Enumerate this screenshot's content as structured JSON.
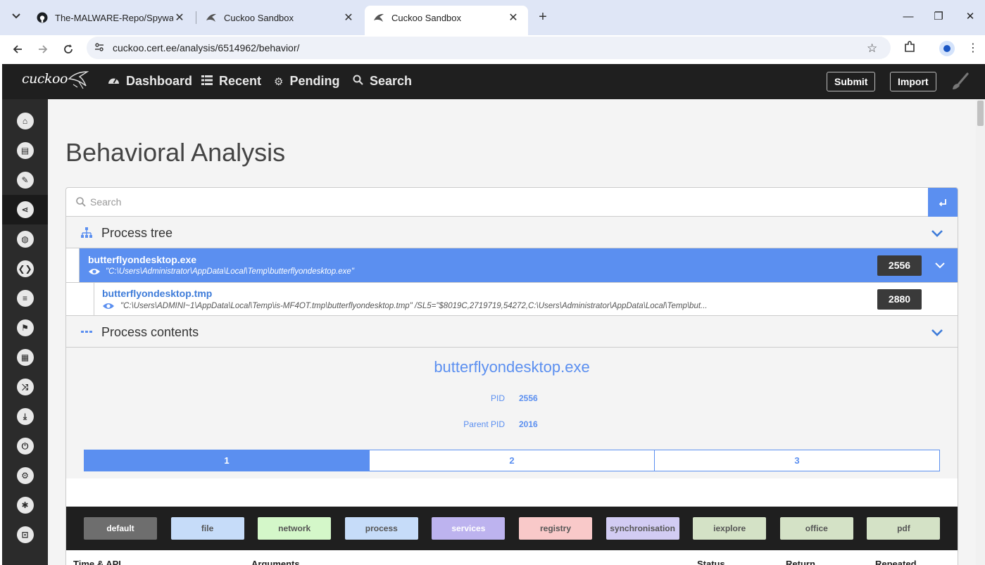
{
  "browser": {
    "tabs": [
      {
        "title": "The-MALWARE-Repo/Spyware/",
        "favicon": "github-icon",
        "active": false
      },
      {
        "title": "Cuckoo Sandbox",
        "favicon": "cuckoo-icon",
        "active": false
      },
      {
        "title": "Cuckoo Sandbox",
        "favicon": "cuckoo-icon",
        "active": true
      }
    ],
    "url": "cuckoo.cert.ee/analysis/6514962/behavior/"
  },
  "navbar": {
    "logo": "cuckoo",
    "items": [
      {
        "label": "Dashboard",
        "icon": "dashboard-icon"
      },
      {
        "label": "Recent",
        "icon": "list-icon"
      },
      {
        "label": "Pending",
        "icon": "cogs-icon"
      },
      {
        "label": "Search",
        "icon": "search-icon"
      }
    ],
    "submit_label": "Submit",
    "import_label": "Import"
  },
  "sidebar": {
    "items": [
      {
        "icon": "home-icon",
        "glyph": "⌂"
      },
      {
        "icon": "book-icon",
        "glyph": "▤"
      },
      {
        "icon": "pencil-icon",
        "glyph": "✎"
      },
      {
        "icon": "share-icon",
        "glyph": "⋖",
        "active": true
      },
      {
        "icon": "globe-icon",
        "glyph": "◍"
      },
      {
        "icon": "file-code-icon",
        "glyph": "❮❯"
      },
      {
        "icon": "server-icon",
        "glyph": "≡"
      },
      {
        "icon": "flag-icon",
        "glyph": "⚑"
      },
      {
        "icon": "qrcode-icon",
        "glyph": "▦"
      },
      {
        "icon": "shuffle-icon",
        "glyph": "⤨"
      },
      {
        "icon": "download-icon",
        "glyph": "⤓"
      },
      {
        "icon": "power-icon",
        "glyph": "⏻"
      },
      {
        "icon": "cogs-icon",
        "glyph": "⚙"
      },
      {
        "icon": "bug-icon",
        "glyph": "✱"
      },
      {
        "icon": "unlock-icon",
        "glyph": "⊡"
      }
    ]
  },
  "page": {
    "title": "Behavioral Analysis",
    "search_placeholder": "Search"
  },
  "process_tree": {
    "title": "Process tree",
    "processes": [
      {
        "name": "butterflyondesktop.exe",
        "cmd": "\"C:\\Users\\Administrator\\AppData\\Local\\Temp\\butterflyondesktop.exe\"",
        "pid": "2556",
        "selected": true
      },
      {
        "name": "butterflyondesktop.tmp",
        "cmd": "\"C:\\Users\\ADMINI~1\\AppData\\Local\\Temp\\is-MF4OT.tmp\\butterflyondesktop.tmp\" /SL5=\"$8019C,2719719,54272,C:\\Users\\Administrator\\AppData\\Local\\Temp\\but...",
        "pid": "2880",
        "selected": false
      }
    ]
  },
  "process_contents": {
    "title": "Process contents",
    "process_name": "butterflyondesktop.exe",
    "pid_label": "PID",
    "pid": "2556",
    "parent_pid_label": "Parent PID",
    "parent_pid": "2016",
    "pages": [
      "1",
      "2",
      "3"
    ],
    "active_page": "1"
  },
  "filters": [
    {
      "label": "default",
      "color": "#6e6e6e",
      "text_color": "#ffffff"
    },
    {
      "label": "file",
      "color": "#c6dcf9",
      "text_color": "#555555"
    },
    {
      "label": "network",
      "color": "#d4f7c9",
      "text_color": "#555555"
    },
    {
      "label": "process",
      "color": "#c6dcf9",
      "text_color": "#555555"
    },
    {
      "label": "services",
      "color": "#bdb3ef",
      "text_color": "#ffffff"
    },
    {
      "label": "registry",
      "color": "#f9c9c9",
      "text_color": "#555555"
    },
    {
      "label": "synchronisation",
      "color": "#d2ccf3",
      "text_color": "#555555"
    },
    {
      "label": "iexplore",
      "color": "#d4e2c6",
      "text_color": "#555555"
    },
    {
      "label": "office",
      "color": "#d4e2c6",
      "text_color": "#555555"
    },
    {
      "label": "pdf",
      "color": "#d4e2c6",
      "text_color": "#555555"
    }
  ],
  "table": {
    "headers": [
      "Time & API",
      "Arguments",
      "Status",
      "Return",
      "Repeated"
    ]
  },
  "colors": {
    "accent": "#5b8ff0",
    "navbar": "#1f1f1f",
    "sidebar": "#2b2b2b"
  }
}
